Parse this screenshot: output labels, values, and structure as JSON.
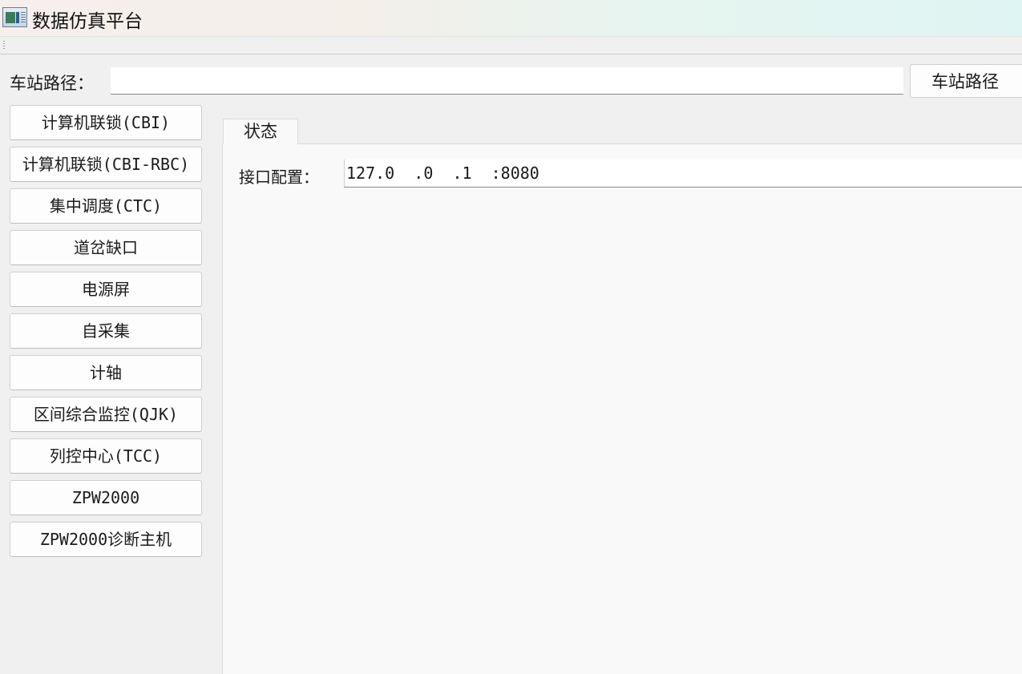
{
  "window": {
    "title": "数据仿真平台",
    "icon": "app-window-icon"
  },
  "station_path": {
    "label": "车站路径：",
    "value": "",
    "button_label": "车站路径"
  },
  "sidebar": {
    "items": [
      {
        "label": "计算机联锁(CBI)"
      },
      {
        "label": "计算机联锁(CBI-RBC)"
      },
      {
        "label": "集中调度(CTC)"
      },
      {
        "label": "道岔缺口"
      },
      {
        "label": "电源屏"
      },
      {
        "label": "自采集"
      },
      {
        "label": "计轴"
      },
      {
        "label": "区间综合监控(QJK)"
      },
      {
        "label": "列控中心(TCC)"
      },
      {
        "label": "ZPW2000"
      },
      {
        "label": "ZPW2000诊断主机"
      }
    ]
  },
  "main": {
    "tabs": [
      {
        "label": "状态",
        "active": true
      }
    ],
    "interface_config": {
      "label": "接口配置：",
      "value": "127.0  .0  .1  :8080"
    }
  }
}
